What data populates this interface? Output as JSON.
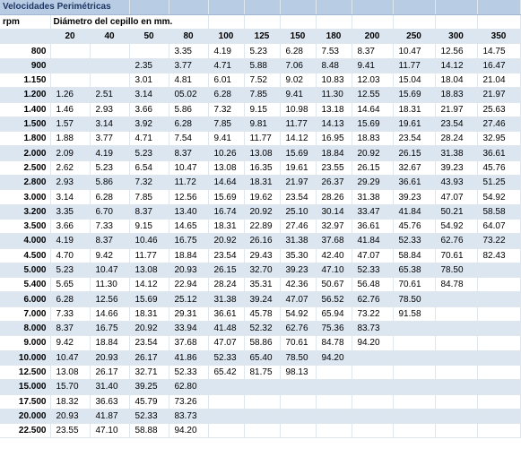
{
  "title": "Velocidades Perimétricas",
  "rpm_label": "rpm",
  "diameter_label": "Diámetro del cepillo en mm.",
  "diameters": [
    "20",
    "40",
    "50",
    "80",
    "100",
    "125",
    "150",
    "180",
    "200",
    "250",
    "300",
    "350"
  ],
  "rows": [
    {
      "rpm": "800",
      "values": [
        "",
        "",
        "",
        "3.35",
        "4.19",
        "5.23",
        "6.28",
        "7.53",
        "8.37",
        "10.47",
        "12.56",
        "14.75"
      ]
    },
    {
      "rpm": "900",
      "values": [
        "",
        "",
        "2.35",
        "3.77",
        "4.71",
        "5.88",
        "7.06",
        "8.48",
        "9.41",
        "11.77",
        "14.12",
        "16.47"
      ]
    },
    {
      "rpm": "1.150",
      "values": [
        "",
        "",
        "3.01",
        "4.81",
        "6.01",
        "7.52",
        "9.02",
        "10.83",
        "12.03",
        "15.04",
        "18.04",
        "21.04"
      ]
    },
    {
      "rpm": "1.200",
      "values": [
        "1.26",
        "2.51",
        "3.14",
        "05.02",
        "6.28",
        "7.85",
        "9.41",
        "11.30",
        "12.55",
        "15.69",
        "18.83",
        "21.97"
      ]
    },
    {
      "rpm": "1.400",
      "values": [
        "1.46",
        "2.93",
        "3.66",
        "5.86",
        "7.32",
        "9.15",
        "10.98",
        "13.18",
        "14.64",
        "18.31",
        "21.97",
        "25.63"
      ]
    },
    {
      "rpm": "1.500",
      "values": [
        "1.57",
        "3.14",
        "3.92",
        "6.28",
        "7.85",
        "9.81",
        "11.77",
        "14.13",
        "15.69",
        "19.61",
        "23.54",
        "27.46"
      ]
    },
    {
      "rpm": "1.800",
      "values": [
        "1.88",
        "3.77",
        "4.71",
        "7.54",
        "9.41",
        "11.77",
        "14.12",
        "16.95",
        "18.83",
        "23.54",
        "28.24",
        "32.95"
      ]
    },
    {
      "rpm": "2.000",
      "values": [
        "2.09",
        "4.19",
        "5.23",
        "8.37",
        "10.26",
        "13.08",
        "15.69",
        "18.84",
        "20.92",
        "26.15",
        "31.38",
        "36.61"
      ]
    },
    {
      "rpm": "2.500",
      "values": [
        "2.62",
        "5.23",
        "6.54",
        "10.47",
        "13.08",
        "16.35",
        "19.61",
        "23.55",
        "26.15",
        "32.67",
        "39.23",
        "45.76"
      ]
    },
    {
      "rpm": "2.800",
      "values": [
        "2.93",
        "5.86",
        "7.32",
        "11.72",
        "14.64",
        "18.31",
        "21.97",
        "26.37",
        "29.29",
        "36.61",
        "43.93",
        "51.25"
      ]
    },
    {
      "rpm": "3.000",
      "values": [
        "3.14",
        "6.28",
        "7.85",
        "12.56",
        "15.69",
        "19.62",
        "23.54",
        "28.26",
        "31.38",
        "39.23",
        "47.07",
        "54.92"
      ]
    },
    {
      "rpm": "3.200",
      "values": [
        "3.35",
        "6.70",
        "8.37",
        "13.40",
        "16.74",
        "20.92",
        "25.10",
        "30.14",
        "33.47",
        "41.84",
        "50.21",
        "58.58"
      ]
    },
    {
      "rpm": "3.500",
      "values": [
        "3.66",
        "7.33",
        "9.15",
        "14.65",
        "18.31",
        "22.89",
        "27.46",
        "32.97",
        "36.61",
        "45.76",
        "54.92",
        "64.07"
      ]
    },
    {
      "rpm": "4.000",
      "values": [
        "4.19",
        "8.37",
        "10.46",
        "16.75",
        "20.92",
        "26.16",
        "31.38",
        "37.68",
        "41.84",
        "52.33",
        "62.76",
        "73.22"
      ]
    },
    {
      "rpm": "4.500",
      "values": [
        "4.70",
        "9.42",
        "11.77",
        "18.84",
        "23.54",
        "29.43",
        "35.30",
        "42.40",
        "47.07",
        "58.84",
        "70.61",
        "82.43"
      ]
    },
    {
      "rpm": "5.000",
      "values": [
        "5.23",
        "10.47",
        "13.08",
        "20.93",
        "26.15",
        "32.70",
        "39.23",
        "47.10",
        "52.33",
        "65.38",
        "78.50",
        ""
      ]
    },
    {
      "rpm": "5.400",
      "values": [
        "5.65",
        "11.30",
        "14.12",
        "22.94",
        "28.24",
        "35.31",
        "42.36",
        "50.67",
        "56.48",
        "70.61",
        "84.78",
        ""
      ]
    },
    {
      "rpm": "6.000",
      "values": [
        "6.28",
        "12.56",
        "15.69",
        "25.12",
        "31.38",
        "39.24",
        "47.07",
        "56.52",
        "62.76",
        "78.50",
        "",
        ""
      ]
    },
    {
      "rpm": "7.000",
      "values": [
        "7.33",
        "14.66",
        "18.31",
        "29.31",
        "36.61",
        "45.78",
        "54.92",
        "65.94",
        "73.22",
        "91.58",
        "",
        ""
      ]
    },
    {
      "rpm": "8.000",
      "values": [
        "8.37",
        "16.75",
        "20.92",
        "33.94",
        "41.48",
        "52.32",
        "62.76",
        "75.36",
        "83.73",
        "",
        "",
        ""
      ]
    },
    {
      "rpm": "9.000",
      "values": [
        "9.42",
        "18.84",
        "23.54",
        "37.68",
        "47.07",
        "58.86",
        "70.61",
        "84.78",
        "94.20",
        "",
        "",
        ""
      ]
    },
    {
      "rpm": "10.000",
      "values": [
        "10.47",
        "20.93",
        "26.17",
        "41.86",
        "52.33",
        "65.40",
        "78.50",
        "94.20",
        "",
        "",
        "",
        ""
      ]
    },
    {
      "rpm": "12.500",
      "values": [
        "13.08",
        "26.17",
        "32.71",
        "52.33",
        "65.42",
        "81.75",
        "98.13",
        "",
        "",
        "",
        "",
        ""
      ]
    },
    {
      "rpm": "15.000",
      "values": [
        "15.70",
        "31.40",
        "39.25",
        "62.80",
        "",
        "",
        "",
        "",
        "",
        "",
        "",
        ""
      ]
    },
    {
      "rpm": "17.500",
      "values": [
        "18.32",
        "36.63",
        "45.79",
        "73.26",
        "",
        "",
        "",
        "",
        "",
        "",
        "",
        ""
      ]
    },
    {
      "rpm": "20.000",
      "values": [
        "20.93",
        "41.87",
        "52.33",
        "83.73",
        "",
        "",
        "",
        "",
        "",
        "",
        "",
        ""
      ]
    },
    {
      "rpm": "22.500",
      "values": [
        "23.55",
        "47.10",
        "58.88",
        "94.20",
        "",
        "",
        "",
        "",
        "",
        "",
        "",
        ""
      ]
    }
  ]
}
